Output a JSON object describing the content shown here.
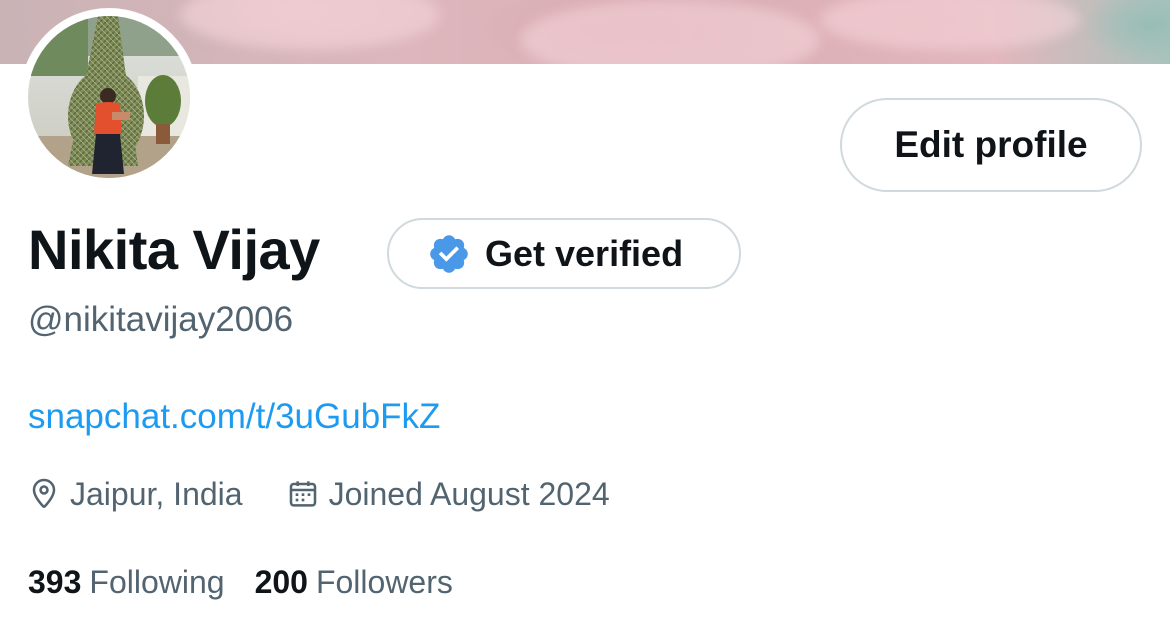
{
  "profile": {
    "display_name": "Nikita Vijay",
    "handle": "@nikitavijay2006",
    "website": "snapchat.com/t/3uGubFkZ",
    "location": "Jaipur, India",
    "joined": "Joined August 2024"
  },
  "buttons": {
    "edit_profile": "Edit profile",
    "get_verified": "Get verified"
  },
  "stats": {
    "following_count": "393",
    "following_label": "Following",
    "followers_count": "200",
    "followers_label": "Followers"
  },
  "icons": {
    "location": "location-pin-icon",
    "calendar": "calendar-icon",
    "verified": "verified-badge-icon"
  },
  "colors": {
    "link": "#1d9bf0",
    "text": "#0f1419",
    "muted": "#536471",
    "badge": "#4a99e9",
    "border": "#cfd9de"
  }
}
